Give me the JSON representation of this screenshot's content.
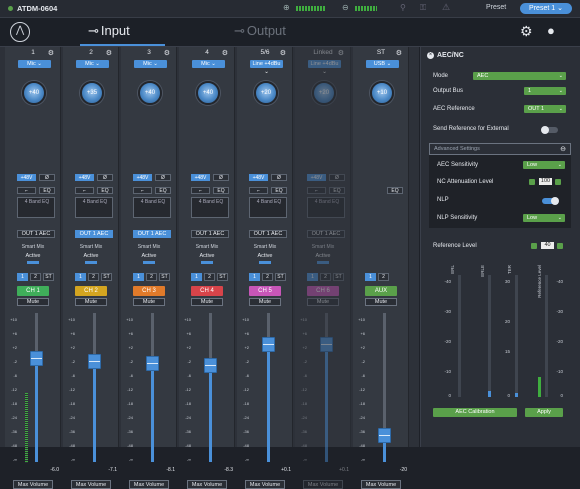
{
  "app": {
    "title": "ATDM-0604",
    "preset_label": "Preset",
    "preset_value": "Preset 1"
  },
  "tabs": [
    {
      "label": "Input",
      "active": true
    },
    {
      "label": "Output",
      "active": false
    }
  ],
  "colors": {
    "accent": "#4a90d9",
    "green": "#5aa04a",
    "bg": "#1e2128"
  },
  "scale_ticks": [
    "+10",
    "+6",
    "+2",
    "-2",
    "-6",
    "-12",
    "-18",
    "-24",
    "-36",
    "-48",
    "-∞"
  ],
  "channels": [
    {
      "num": "1",
      "input": "Mic",
      "knob": "+40",
      "phantom": "+48V",
      "phase": "Ø",
      "eq": "EQ",
      "eq_label": "4 Band EQ",
      "out": "OUT 1 AEC",
      "out_on": false,
      "smart": "Smart Mix",
      "active": "Active",
      "b1": "1",
      "b2": "2",
      "b3": "ST",
      "name": "CH 1",
      "color": "#3fae5a",
      "mute": "Mute",
      "gain": "-6.0",
      "level": 0.72,
      "maxvol": "Max Volume"
    },
    {
      "num": "2",
      "input": "Mic",
      "knob": "+35",
      "phantom": "+48V",
      "phase": "Ø",
      "eq": "EQ",
      "eq_label": "4 Band EQ",
      "out": "OUT 1 AEC",
      "out_on": true,
      "smart": "Smart Mix",
      "active": "Active",
      "b1": "1",
      "b2": "2",
      "b3": "ST",
      "name": "CH 2",
      "color": "#d4a520",
      "mute": "Mute",
      "gain": "-7.1",
      "level": 0.7,
      "maxvol": "Max Volume"
    },
    {
      "num": "3",
      "input": "Mic",
      "knob": "+40",
      "phantom": "+48V",
      "phase": "Ø",
      "eq": "EQ",
      "eq_label": "4 Band EQ",
      "out": "OUT 1 AEC",
      "out_on": true,
      "smart": "Smart Mix",
      "active": "Active",
      "b1": "1",
      "b2": "2",
      "b3": "ST",
      "name": "CH 3",
      "color": "#e07a2a",
      "mute": "Mute",
      "gain": "-8.1",
      "level": 0.68,
      "maxvol": "Max Volume"
    },
    {
      "num": "4",
      "input": "Mic",
      "knob": "+40",
      "phantom": "+48V",
      "phase": "Ø",
      "eq": "EQ",
      "eq_label": "4 Band EQ",
      "out": "OUT 1 AEC",
      "out_on": false,
      "smart": "Smart Mix",
      "active": "Active",
      "b1": "1",
      "b2": "2",
      "b3": "ST",
      "name": "CH 4",
      "color": "#d8444a",
      "mute": "Mute",
      "gain": "-8.3",
      "level": 0.67,
      "maxvol": "Max Volume"
    },
    {
      "num": "5/6",
      "input": "Line +4dBu",
      "knob": "+20",
      "phantom": "+48V",
      "phase": "Ø",
      "eq": "EQ",
      "eq_label": "4 Band EQ",
      "out": "OUT 1 AEC",
      "out_on": false,
      "smart": "Smart Mix",
      "active": "Active",
      "b1": "1",
      "b2": "2",
      "b3": "ST",
      "name": "CH 5",
      "color": "#c856b8",
      "mute": "Mute",
      "gain": "+0.1",
      "level": 0.82,
      "maxvol": "Max Volume"
    },
    {
      "num": "Linked",
      "input": "Line +4dBu",
      "knob": "+20",
      "phantom": "+48V",
      "phase": "Ø",
      "eq": "EQ",
      "eq_label": "4 Band EQ",
      "out": "OUT 1 AEC",
      "out_on": false,
      "smart": "Smart Mix",
      "active": "Active",
      "b1": "1",
      "b2": "2",
      "b3": "ST",
      "name": "CH 6",
      "color": "#c856b8",
      "mute": "Mute",
      "gain": "+0.1",
      "level": 0.82,
      "maxvol": "Max Volume",
      "dim": true
    },
    {
      "num": "ST",
      "input": "USB",
      "knob": "+10",
      "phantom": "",
      "phase": "",
      "eq": "EQ",
      "eq_label": "",
      "out": "",
      "out_on": false,
      "smart": "",
      "active": "",
      "b1": "1",
      "b2": "2",
      "b3": "",
      "name": "AUX",
      "color": "#5aa04a",
      "mute": "Mute",
      "gain": "-20",
      "level": 0.15,
      "maxvol": "Max Volume"
    }
  ],
  "panel": {
    "title": "AEC/NC",
    "mode_label": "Mode",
    "mode": "AEC",
    "bus_label": "Output Bus",
    "bus": "1",
    "ref_label": "AEC Reference",
    "ref": "OUT 1",
    "send_label": "Send Reference for External",
    "adv_label": "Advanced Settings",
    "sens_label": "AEC Sensitivity",
    "sens": "Low",
    "nc_label": "NC Attenuation Level",
    "nc": "100",
    "nlp_label": "NLP",
    "nlps_label": "NLP Sensitivity",
    "nlps": "Low",
    "reflevel_label": "Reference Level",
    "reflevel": "40",
    "cols": [
      "ERL",
      "ERLE",
      "TER",
      "Reference Level"
    ],
    "scale_a": [
      "-40",
      "-30",
      "-20",
      "-10",
      "0"
    ],
    "scale_b": [
      "30",
      "",
      "20",
      "15",
      "0"
    ],
    "cal": "AEC Calibration",
    "apply": "Apply"
  }
}
